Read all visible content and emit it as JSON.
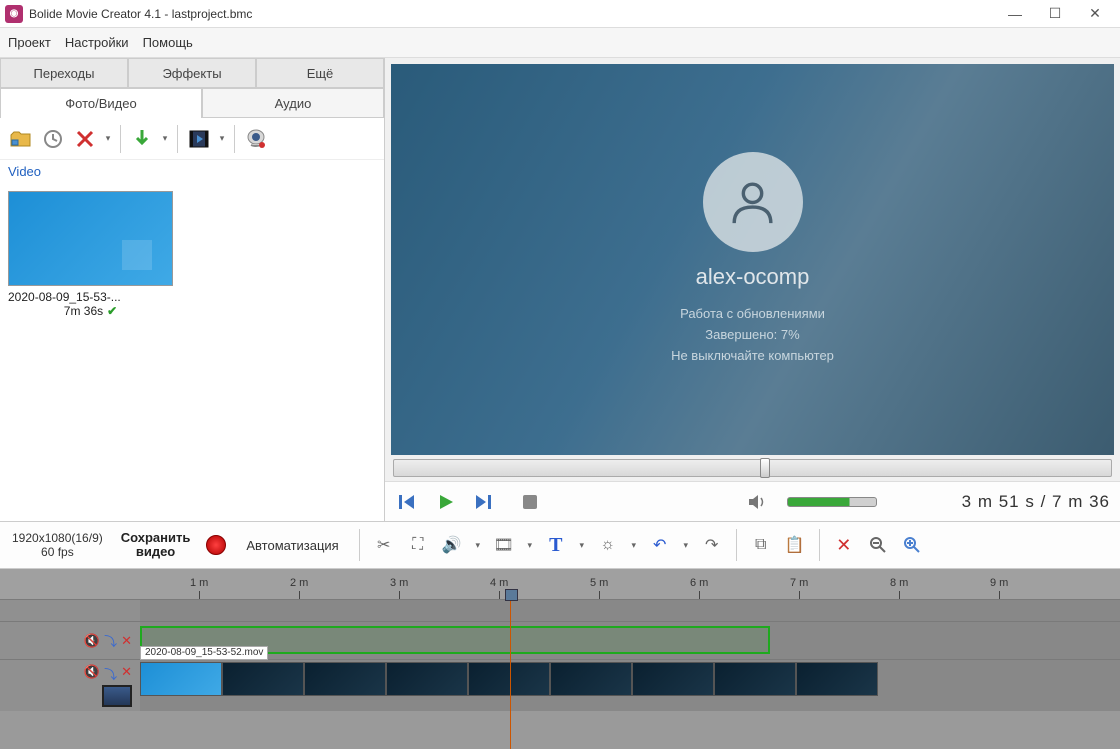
{
  "title": "Bolide Movie Creator 4.1 - lastproject.bmc",
  "menubar": {
    "project": "Проект",
    "settings": "Настройки",
    "help": "Помощь"
  },
  "tabs": {
    "transitions": "Переходы",
    "effects": "Эффекты",
    "more": "Ещё",
    "photovideo": "Фото/Видео",
    "audio": "Аудио"
  },
  "media": {
    "label": "Video",
    "filename": "2020-08-09_15-53-...",
    "duration": "7m 36s"
  },
  "preview": {
    "username": "alex-ocomp",
    "line1": "Работа с обновлениями",
    "line2": "Завершено: 7%",
    "line3": "Не выключайте компьютер",
    "time": "3 m 51 s   /  7 m 36"
  },
  "toolbar": {
    "resolution": "1920x1080(16/9)",
    "fps": "60 fps",
    "save_line1": "Сохранить",
    "save_line2": "видео",
    "automation": "Автоматизация"
  },
  "timeline": {
    "ticks": [
      "1 m",
      "2 m",
      "3 m",
      "4 m",
      "5 m",
      "6 m",
      "7 m",
      "8 m",
      "9 m"
    ],
    "clip_filename": "2020-08-09_15-53-52.mov"
  }
}
